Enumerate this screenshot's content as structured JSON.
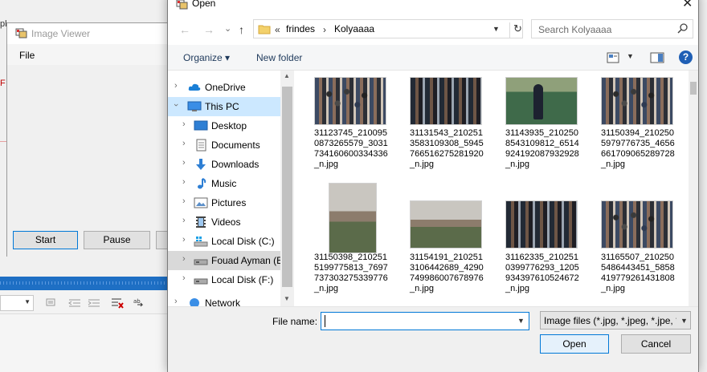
{
  "background_app": {
    "fragment_top": "pl",
    "fragment_left": "F",
    "viewer": {
      "title": "Image Viewer",
      "menu_file": "File",
      "buttons": {
        "start": "Start",
        "pause": "Pause"
      }
    }
  },
  "dialog": {
    "title": "Open",
    "close": "✕",
    "nav": {
      "back": "←",
      "forward": "→",
      "dropdown": "⌄",
      "up": "↑"
    },
    "address": {
      "overflow": "«",
      "crumbs": [
        "frindes",
        "Kolyaaaa"
      ],
      "separator": "›"
    },
    "search": {
      "placeholder": "Search Kolyaaaa"
    },
    "toolbar": {
      "organize": "Organize ▾",
      "new_folder": "New folder",
      "help": "?"
    },
    "nav_items": [
      {
        "label": "OneDrive",
        "icon": "cloud-icon",
        "state": ""
      },
      {
        "label": "This PC",
        "icon": "computer-icon",
        "state": "selected",
        "expanded": true
      },
      {
        "label": "Desktop",
        "icon": "desktop-icon",
        "state": ""
      },
      {
        "label": "Documents",
        "icon": "documents-icon",
        "state": ""
      },
      {
        "label": "Downloads",
        "icon": "downloads-icon",
        "state": ""
      },
      {
        "label": "Music",
        "icon": "music-icon",
        "state": ""
      },
      {
        "label": "Pictures",
        "icon": "pictures-icon",
        "state": ""
      },
      {
        "label": "Videos",
        "icon": "videos-icon",
        "state": ""
      },
      {
        "label": "Local Disk (C:)",
        "icon": "drive-icon",
        "state": ""
      },
      {
        "label": "Fouad Ayman (E",
        "icon": "drive-icon",
        "state": "hover"
      },
      {
        "label": "Local Disk (F:)",
        "icon": "drive-icon",
        "state": ""
      },
      {
        "label": "Network",
        "icon": "network-icon",
        "state": ""
      }
    ],
    "files": [
      {
        "name": "31123745_2100950873265579_3031734160600334336_n.jpg"
      },
      {
        "name": "31131543_2102513583109308_5945766516275281920_n.jpg"
      },
      {
        "name": "31143935_2102508543109812_6514924192087932928_n.jpg"
      },
      {
        "name": "31150394_2102505979776735_4656661709065289728_n.jpg"
      },
      {
        "name": "31150398_2102515199775813_7697737303275339776_n.jpg"
      },
      {
        "name": "31154191_2102513106442689_4290749986007678976_n.jpg"
      },
      {
        "name": "31162335_2102510399776293_1205934397610524672_n.jpg"
      },
      {
        "name": "31165507_2102505486443451_5858419779261431808_n.jpg"
      }
    ],
    "bottom": {
      "file_name_label": "File name:",
      "file_name_value": "",
      "file_type": "Image files (*.jpg, *.jpeg, *.jpe, *",
      "open": "Open",
      "cancel": "Cancel"
    }
  }
}
